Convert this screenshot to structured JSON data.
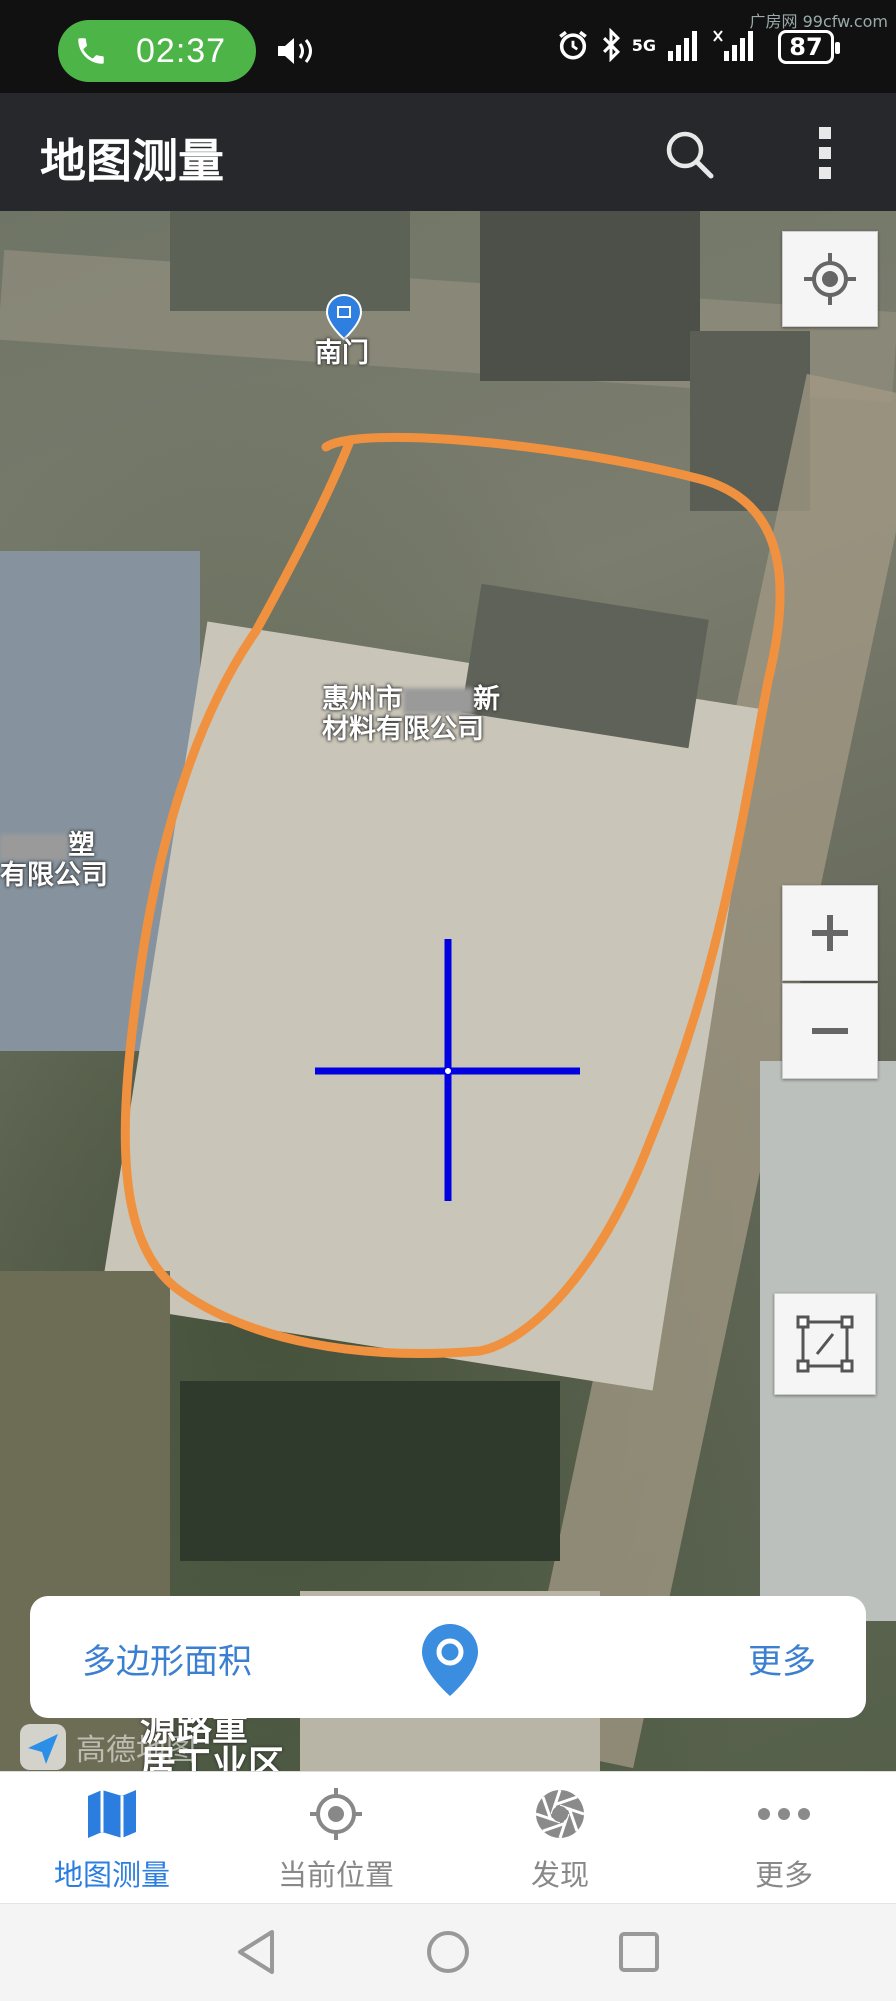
{
  "status_bar": {
    "time": "02:37",
    "battery": "87",
    "network_label": "5G",
    "watermark": "广房网 99cfw.com"
  },
  "app_bar": {
    "title": "地图测量"
  },
  "map": {
    "poi_gate": "南门",
    "poi_company_line1": "惠州市",
    "poi_company_suffix": "新",
    "poi_company_line2": "材料有限公司",
    "poi_left_line1": "塑",
    "poi_left_line2": "有限公司",
    "road_line1": "源路重",
    "road_line2": "居工业区",
    "provider": "高德地图"
  },
  "measure_card": {
    "mode_label": "多边形面积",
    "more_label": "更多"
  },
  "tabs": [
    {
      "label": "地图测量",
      "icon": "map-icon",
      "active": true
    },
    {
      "label": "当前位置",
      "icon": "locate-icon",
      "active": false
    },
    {
      "label": "发现",
      "icon": "discover-icon",
      "active": false
    },
    {
      "label": "更多",
      "icon": "more-dots-icon",
      "active": false
    }
  ],
  "colors": {
    "accent": "#2b7de0",
    "outline": "#f0913f",
    "crosshair": "#0000e0"
  }
}
